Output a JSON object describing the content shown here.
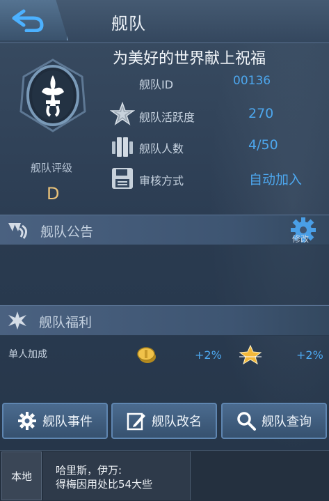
{
  "header": {
    "title": "舰队",
    "back_icon": "back-arrow-icon"
  },
  "fleet": {
    "name": "为美好的世界献上祝福",
    "rating_label": "舰队评级",
    "rating_value": "D",
    "emblem_icon": "fleur-de-lis-emblem-icon",
    "rows": [
      {
        "label": "舰队ID",
        "value": "00136",
        "icon": null
      },
      {
        "label": "舰队活跃度",
        "value": "270",
        "icon": "star-icon"
      },
      {
        "label": "舰队人数",
        "value": "4/50",
        "icon": "members-icon"
      },
      {
        "label": "审核方式",
        "value": "自动加入",
        "icon": "save-disk-icon"
      }
    ]
  },
  "notice": {
    "label": "舰队公告",
    "edit_label": "修改",
    "icon": "announcement-icon"
  },
  "benefits": {
    "label": "舰队福利",
    "icon": "sparkle-icon",
    "bonus_label": "单人加成",
    "coin_bonus": "+2%",
    "star_bonus": "+2%"
  },
  "actions": [
    {
      "label": "舰队事件",
      "icon": "gear-icon"
    },
    {
      "label": "舰队改名",
      "icon": "edit-icon"
    },
    {
      "label": "舰队查询",
      "icon": "search-icon"
    }
  ],
  "chat": {
    "tab_label": "本地",
    "line1": "哈里斯，伊万:",
    "line2": "得梅因用处比54大些"
  },
  "colors": {
    "accent": "#4da7ee",
    "rating": "#e9c27a",
    "bg": "#2b3c52"
  }
}
